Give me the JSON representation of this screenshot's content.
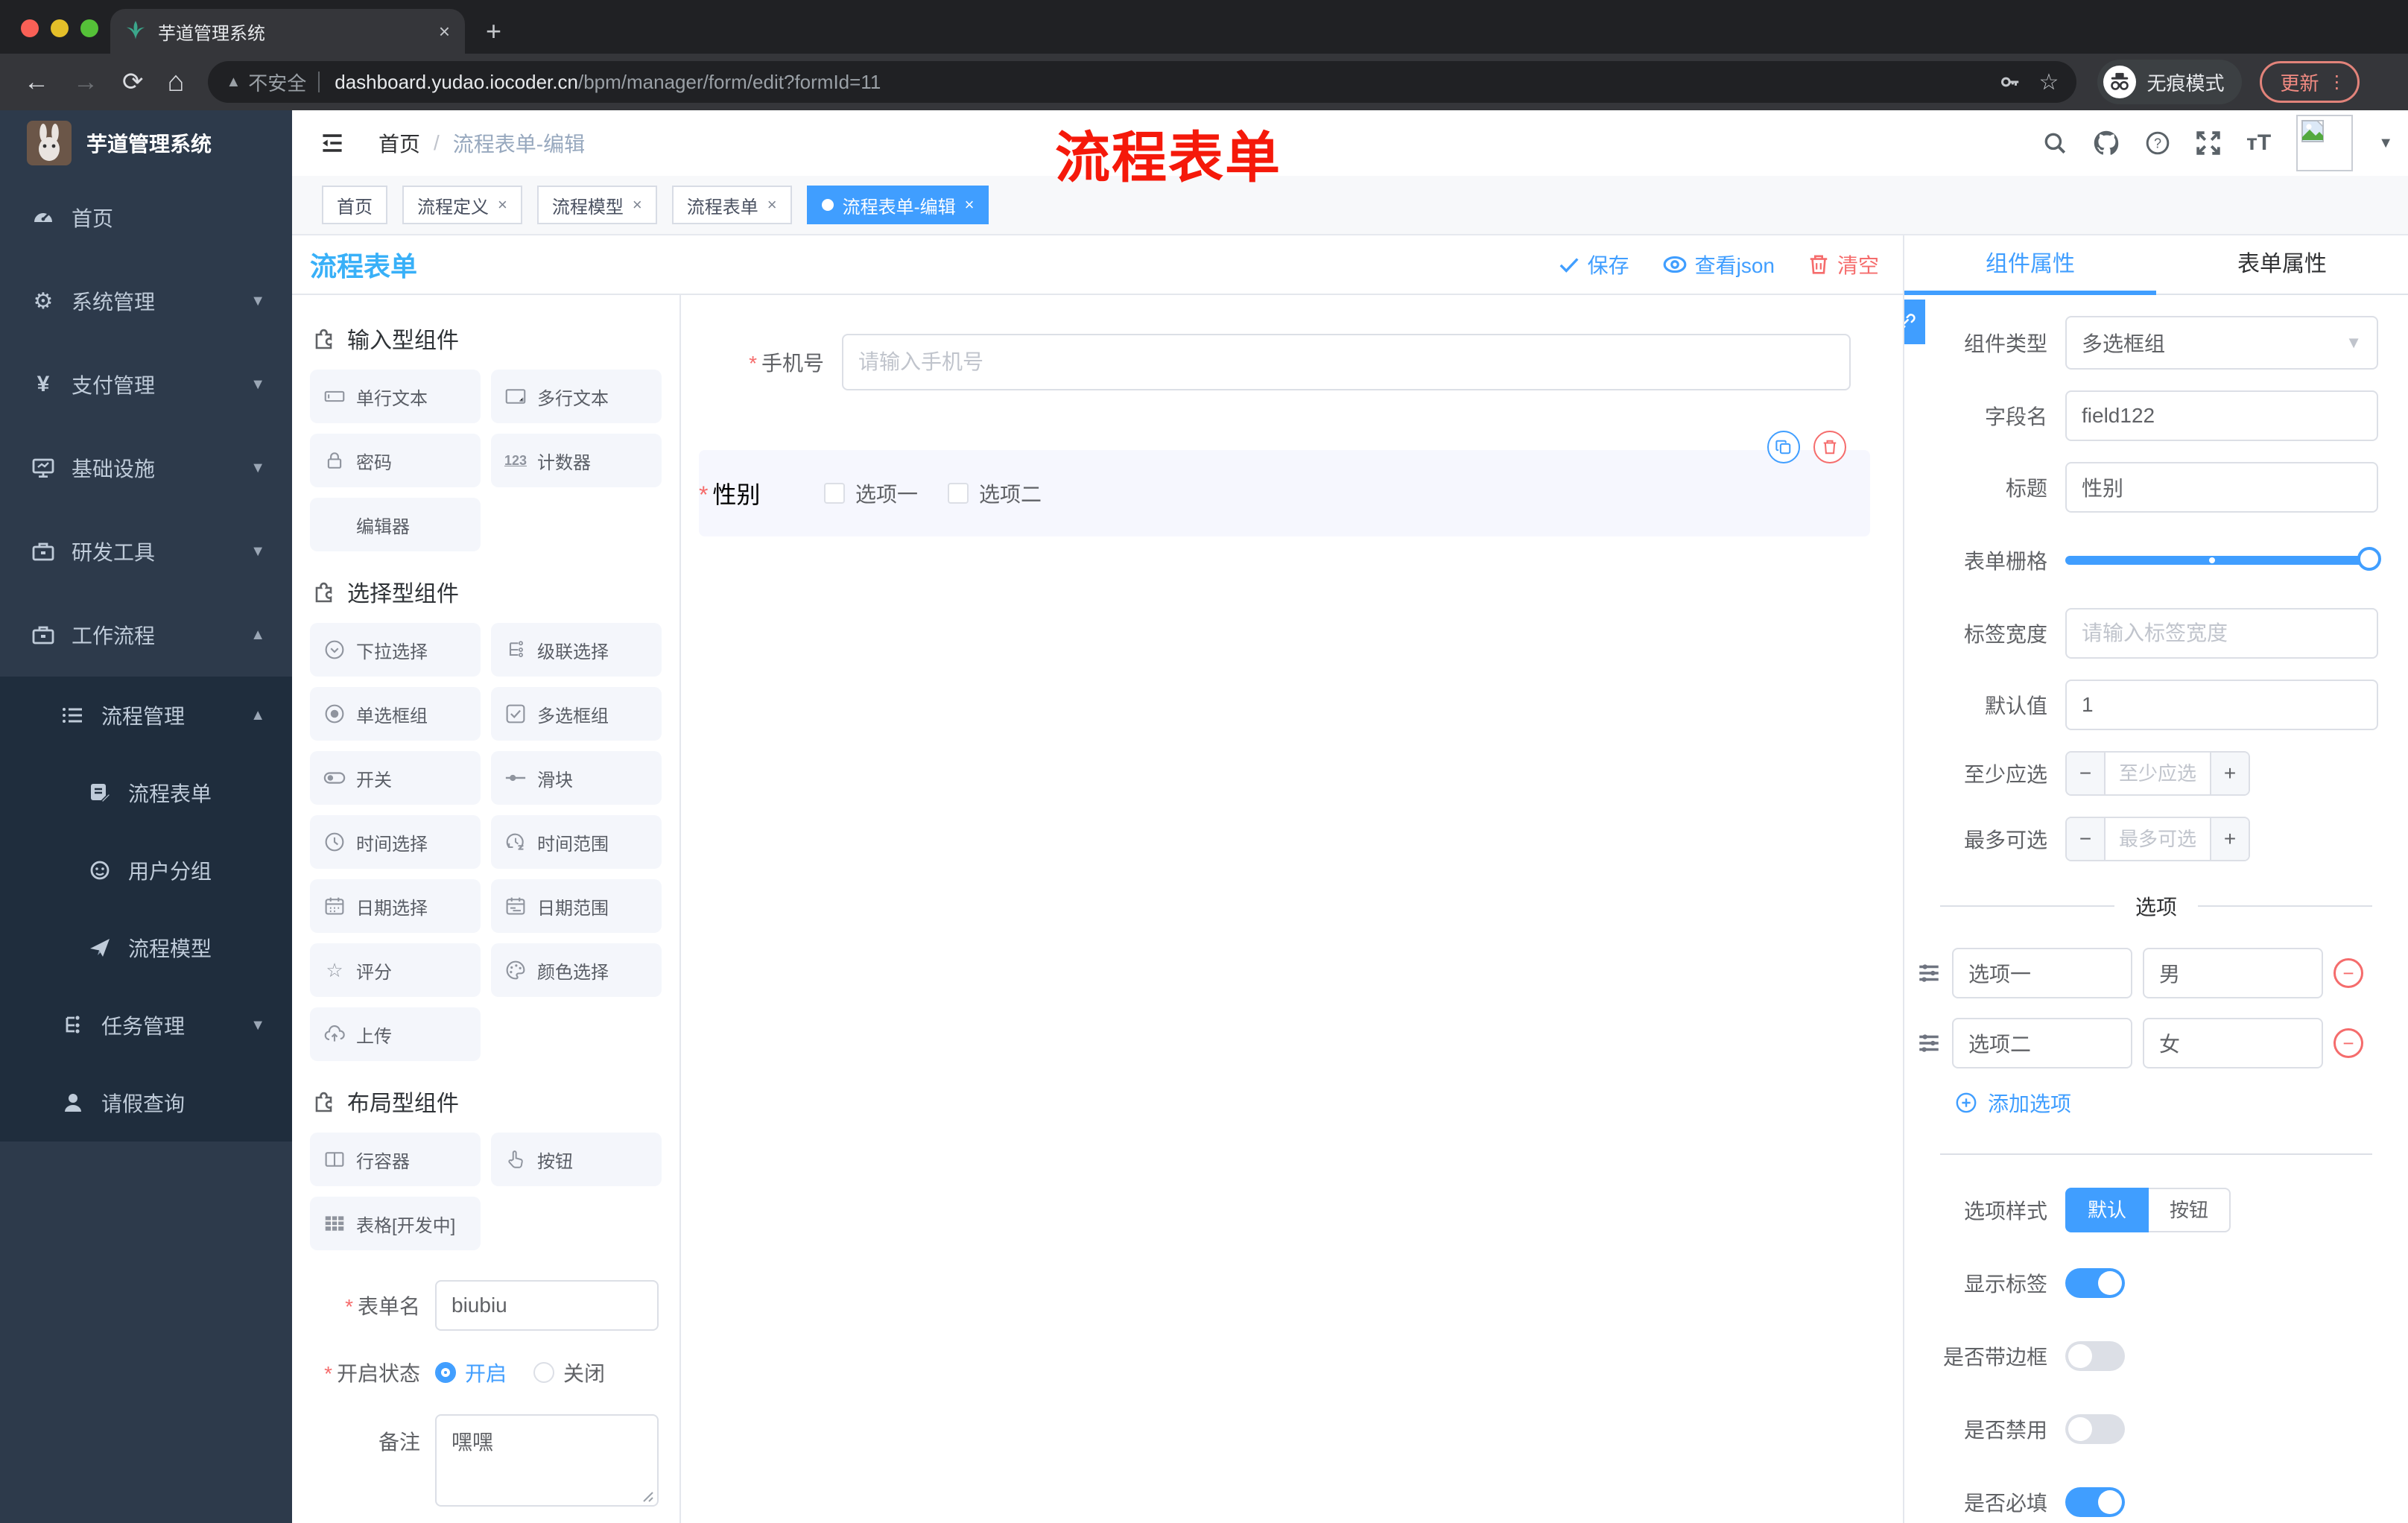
{
  "browser": {
    "tab_title": "芋道管理系统",
    "close_tab": "×",
    "new_tab": "+",
    "security_label": "不安全",
    "url_host": "dashboard.yudao.iocoder.cn",
    "url_path": "/bpm/manager/form/edit?formId=11",
    "incognito_label": "无痕模式",
    "update_label": "更新"
  },
  "sidebar": {
    "app_title": "芋道管理系统",
    "items": {
      "home": "首页",
      "system": "系统管理",
      "payment": "支付管理",
      "infra": "基础设施",
      "devtools": "研发工具",
      "workflow": "工作流程",
      "process_mgmt": "流程管理",
      "process_form": "流程表单",
      "user_group": "用户分组",
      "process_model": "流程模型",
      "task_mgmt": "任务管理",
      "leave_query": "请假查询"
    }
  },
  "header": {
    "breadcrumb_home": "首页",
    "breadcrumb_sep": "/",
    "breadcrumb_current": "流程表单-编辑",
    "annotation": "流程表单"
  },
  "tags": {
    "t0": "首页",
    "t1": "流程定义",
    "t2": "流程模型",
    "t3": "流程表单",
    "t4": "流程表单-编辑",
    "close": "×"
  },
  "content": {
    "title": "流程表单",
    "toolbar": {
      "save": "保存",
      "view_json": "查看json",
      "clear": "清空"
    }
  },
  "components_panel": {
    "section_input": "输入型组件",
    "section_select": "选择型组件",
    "section_layout": "布局型组件",
    "input_items": [
      "单行文本",
      "多行文本",
      "密码",
      "计数器",
      "编辑器"
    ],
    "select_items": [
      "下拉选择",
      "级联选择",
      "单选框组",
      "多选框组",
      "开关",
      "滑块",
      "时间选择",
      "时间范围",
      "日期选择",
      "日期范围",
      "评分",
      "颜色选择",
      "上传"
    ],
    "layout_items": [
      "行容器",
      "按钮",
      "表格[开发中]"
    ],
    "form": {
      "name_label": "表单名",
      "name_value": "biubiu",
      "status_label": "开启状态",
      "status_on": "开启",
      "status_off": "关闭",
      "remark_label": "备注",
      "remark_value": "嘿嘿"
    }
  },
  "canvas": {
    "phone_label": "手机号",
    "phone_placeholder": "请输入手机号",
    "gender_label": "性别",
    "gender_option1": "选项一",
    "gender_option2": "选项二"
  },
  "props_panel": {
    "tab_component": "组件属性",
    "tab_form": "表单属性",
    "type_label": "组件类型",
    "type_value": "多选框组",
    "field_label": "字段名",
    "field_value": "field122",
    "title_label": "标题",
    "title_value": "性别",
    "grid_label": "表单栅格",
    "label_width_label": "标签宽度",
    "label_width_placeholder": "请输入标签宽度",
    "default_label": "默认值",
    "default_value": "1",
    "min_label": "至少应选",
    "min_placeholder": "至少应选",
    "max_label": "最多可选",
    "max_placeholder": "最多可选",
    "options_divider": "选项",
    "option1_label": "选项一",
    "option1_value": "男",
    "option2_label": "选项二",
    "option2_value": "女",
    "add_option": "添加选项",
    "style_label": "选项样式",
    "style_default": "默认",
    "style_button": "按钮",
    "show_label": "显示标签",
    "with_border": "是否带边框",
    "disabled": "是否禁用",
    "required": "是否必填"
  },
  "colors": {
    "accent": "#409eff",
    "danger": "#f56c6c",
    "title_blue": "#38b0f8",
    "annotation_red": "#f5190a"
  }
}
